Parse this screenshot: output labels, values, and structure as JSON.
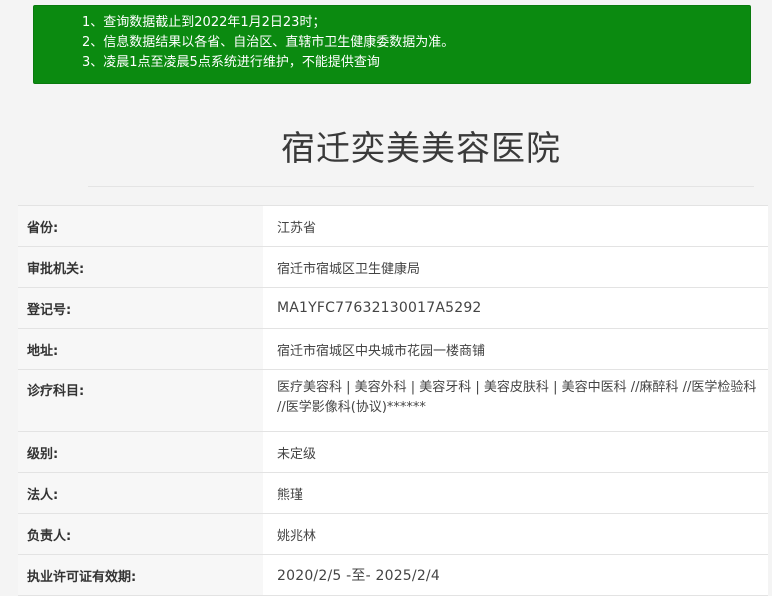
{
  "notice": {
    "lines": [
      "1、查询数据截止到2022年1月2日23时；",
      "2、信息数据结果以各省、自治区、直辖市卫生健康委数据为准。",
      "3、凌晨1点至凌晨5点系统进行维护，不能提供查询"
    ],
    "background_color": "#0b8a10"
  },
  "title": "宿迁奕美美容医院",
  "info": {
    "province": {
      "label": "省份:",
      "value": "江苏省"
    },
    "authority": {
      "label": "审批机关:",
      "value": "宿迁市宿城区卫生健康局"
    },
    "registration": {
      "label": "登记号:",
      "value": "MA1YFC77632130017A5292"
    },
    "address": {
      "label": "地址:",
      "value": "宿迁市宿城区中央城市花园一楼商铺"
    },
    "departments": {
      "label": "诊疗科目:",
      "value": "医疗美容科 | 美容外科 | 美容牙科 | 美容皮肤科 | 美容中医科 //麻醉科 //医学检验科 //医学影像科(协议)******"
    },
    "level": {
      "label": "级别:",
      "value": "未定级"
    },
    "legal_person": {
      "label": "法人:",
      "value": "熊瑾"
    },
    "person_in_charge": {
      "label": "负责人:",
      "value": "姚兆林"
    },
    "license_validity": {
      "label": "执业许可证有效期:",
      "value": "2020/2/5 -至- 2025/2/4"
    }
  }
}
